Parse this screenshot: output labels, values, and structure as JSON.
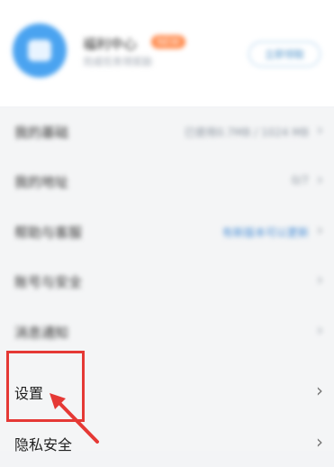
{
  "header": {
    "name": "福利中心",
    "badge": "NEW",
    "subtitle": "完成任务领奖励",
    "button_label": "立即领取"
  },
  "rows": [
    {
      "label": "我的基础",
      "value": "已使用0.7MB / 1024 MB",
      "value_style": "plain"
    },
    {
      "label": "我的地址",
      "value": "0/7",
      "value_style": "plain"
    },
    {
      "label": "帮助与客服",
      "value": "有新版本可以更新",
      "value_style": "link"
    },
    {
      "label": "账号与安全",
      "value": "",
      "value_style": "plain"
    },
    {
      "label": "消息通知",
      "value": "",
      "value_style": "plain"
    },
    {
      "label": "设置",
      "value": "",
      "value_style": "plain"
    },
    {
      "label": "隐私安全",
      "value": "",
      "value_style": "plain"
    }
  ],
  "chevron": "›",
  "annotation": {
    "color": "#e53935"
  }
}
